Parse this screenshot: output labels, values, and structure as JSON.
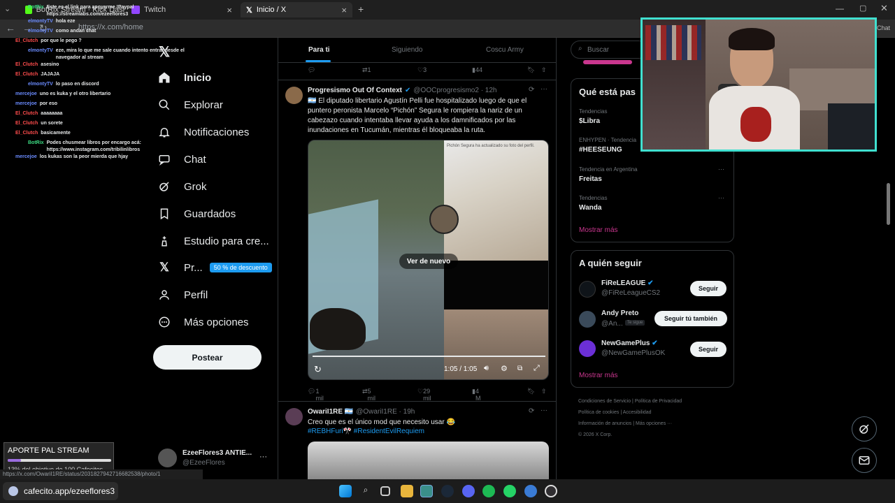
{
  "browser": {
    "tabs": [
      {
        "label": "BotRix  Stream · Kick Dashboard"
      },
      {
        "label": "Twitch"
      },
      {
        "label": "Inicio / X"
      }
    ],
    "url": "https://x.com/home",
    "chat_label": "Chat",
    "status_url": "https://x.com/OwariI1RE/status/2031827942716682538/photo/1"
  },
  "nav": {
    "items": [
      {
        "label": "Inicio",
        "icon": "home-icon"
      },
      {
        "label": "Explorar",
        "icon": "search-icon"
      },
      {
        "label": "Notificaciones",
        "icon": "bell-icon"
      },
      {
        "label": "Chat",
        "icon": "chat-icon"
      },
      {
        "label": "Grok",
        "icon": "grok-icon"
      },
      {
        "label": "Guardados",
        "icon": "bookmark-icon"
      },
      {
        "label": "Estudio para cre...",
        "icon": "studio-icon"
      },
      {
        "label": "Pr...",
        "icon": "x-logo-icon"
      },
      {
        "label": "Perfil",
        "icon": "user-icon"
      },
      {
        "label": "Más opciones",
        "icon": "more-icon"
      }
    ],
    "premium_badge": "50 % de descuento",
    "post_button": "Postear",
    "account_name": "EzeeFlores3 ANTIE...",
    "account_handle": "@EzeeFlores",
    "account_more": "···"
  },
  "feed": {
    "tabs": [
      "Para ti",
      "Siguiendo",
      "Coscu Army"
    ],
    "prev_actions": {
      "replies": "",
      "reposts": "1",
      "likes": "3",
      "views": "44"
    },
    "post1": {
      "name": "Progresismo Out Of Context",
      "handle": "@OOCprogresismo2 · 12h",
      "text": "🇦🇷 El diputado libertario Agustín Pelli fue hospitalizado luego de que el puntero peronista Marcelo “Pichón” Segura le rompiera la nariz de un cabezazo cuando intentaba llevar ayuda a los damnificados por las inundaciones en Tucumán, mientras él bloqueaba la ruta.",
      "video_replay": "Ver de nuevo",
      "video_time": "1:05 / 1:05",
      "inset_caption": "Pichón Segura ha actualizado su foto del perfil.",
      "actions": {
        "replies": "1 mil",
        "reposts": "5 mil",
        "likes": "29 mil",
        "views": "4 M"
      }
    },
    "post2": {
      "name": "OwariI1RE 🇦🇷",
      "handle": "@OwariI1RE · 19h",
      "text": "Creo que es el único mod que necesito usar 😂",
      "hashtags": "#REBHFuri🎌 #ResidentEvilRequiem"
    }
  },
  "right": {
    "search_placeholder": "Buscar",
    "trends_title": "Qué está pas",
    "trends": [
      {
        "meta": "Tendencias",
        "name": "$Libra"
      },
      {
        "meta": "ENHYPEN · Tendencia",
        "name": "#HEESEUNG"
      },
      {
        "meta": "Tendencia en Argentina",
        "name": "Freitas"
      },
      {
        "meta": "Tendencias",
        "name": "Wanda"
      }
    ],
    "trends_more": "Mostrar más",
    "follow_title": "A quién seguir",
    "follow": [
      {
        "name": "FiReLEAGUE",
        "handle": "@FiReLeagueCS2",
        "button": "Seguir",
        "tag": ""
      },
      {
        "name": "Andy Preto",
        "handle": "@An...",
        "button": "Seguir tú también",
        "tag": "Te sigue"
      },
      {
        "name": "NewGamePlus",
        "handle": "@NewGamePlusOK",
        "button": "Seguir",
        "tag": ""
      }
    ],
    "follow_more": "Mostrar más",
    "footer": [
      "Condiciones de Servicio",
      "Política de Privacidad",
      "Política de cookies",
      "Accesibilidad",
      "Información de anuncios",
      "Más opciones ···",
      "© 2026 X Corp."
    ]
  },
  "stream_chat": [
    {
      "user": "BotRix",
      "msg": "Este es el link para apoyarme !Paypal https://streamlabs.com/ezeeflores3",
      "color": "#3ddc84"
    },
    {
      "user": "elmontyTV",
      "msg": "hola eze",
      "color": "#6b8cff"
    },
    {
      "user": "elmontyTV",
      "msg": "como andan chat",
      "color": "#6b8cff"
    },
    {
      "user": "El_Clutch",
      "msg": "por que le pego ?",
      "color": "#ff4d4d"
    },
    {
      "user": "elmontyTV",
      "msg": "eze, mira lo que me sale cuando intento entrar desde el navegador al stream",
      "color": "#6b8cff"
    },
    {
      "user": "El_Clutch",
      "msg": "asesino",
      "color": "#ff4d4d"
    },
    {
      "user": "El_Clutch",
      "msg": "JAJAJA",
      "color": "#ff4d4d"
    },
    {
      "user": "elmontyTV",
      "msg": "lo paso en discord",
      "color": "#6b8cff"
    },
    {
      "user": "mercejoe",
      "msg": "uno es kuka y el otro libertario",
      "color": "#6b8cff"
    },
    {
      "user": "mercejoe",
      "msg": "por eso",
      "color": "#6b8cff"
    },
    {
      "user": "El_Clutch",
      "msg": "aaaaaaaa",
      "color": "#ff4d4d"
    },
    {
      "user": "El_Clutch",
      "msg": "un sorete",
      "color": "#ff4d4d"
    },
    {
      "user": "El_Clutch",
      "msg": "basicamente",
      "color": "#ff4d4d"
    },
    {
      "user": "BotRix",
      "msg": "Podes chusmear libros por encargo acá: https://www.instagram.com/tribilinlibros",
      "color": "#3ddc84"
    },
    {
      "user": "mercejoe",
      "msg": "los kukas son la peor mierda que hjay",
      "color": "#6b8cff"
    }
  ],
  "donation": {
    "title": "APORTE PAL STREAM",
    "progress_text": "13% del objetivo de 100 Cafecitos",
    "progress": 0.13
  },
  "cafecito": "cafecito.app/ezeeflores3",
  "colors": {
    "accent": "#1d9bf0",
    "pink": "#c9368e",
    "cam_border": "#40e0d0"
  }
}
